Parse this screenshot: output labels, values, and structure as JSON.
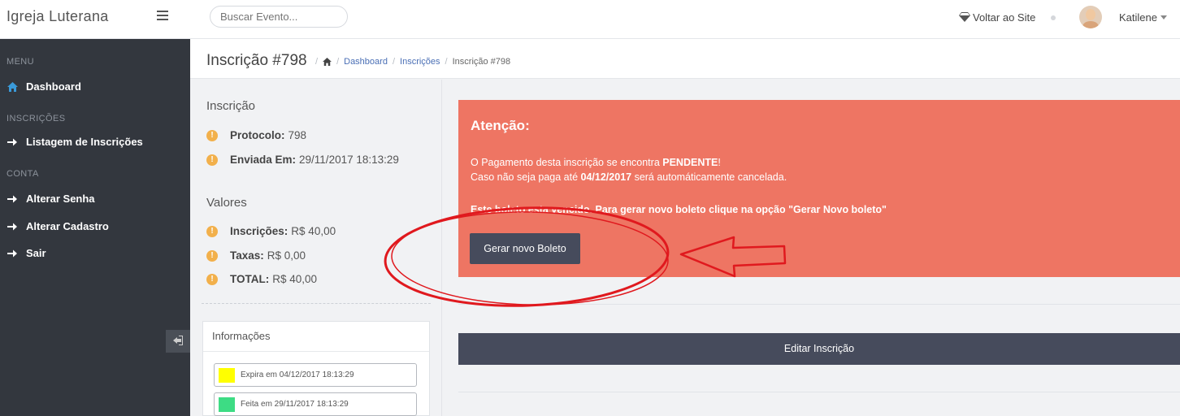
{
  "topbar": {
    "brand": "Igreja Luterana",
    "search_placeholder": "Buscar Evento...",
    "voltar_label": "Voltar ao Site",
    "user_name": "Katilene"
  },
  "sidebar": {
    "sections": [
      {
        "label": "MENU",
        "items": [
          {
            "label": "Dashboard",
            "icon": "home-icon"
          }
        ]
      },
      {
        "label": "INSCRIÇÕES",
        "items": [
          {
            "label": "Listagem de Inscrições",
            "icon": "arrow-right-icon"
          }
        ]
      },
      {
        "label": "CONTA",
        "items": [
          {
            "label": "Alterar Senha",
            "icon": "arrow-right-icon"
          },
          {
            "label": "Alterar Cadastro",
            "icon": "arrow-right-icon"
          },
          {
            "label": "Sair",
            "icon": "arrow-right-icon"
          }
        ]
      }
    ]
  },
  "page": {
    "title": "Inscrição #798",
    "breadcrumb": [
      "Dashboard",
      "Inscrições",
      "Inscrição #798"
    ]
  },
  "inscricao": {
    "heading": "Inscrição",
    "protocolo_label": "Protocolo:",
    "protocolo_value": "798",
    "enviada_label": "Enviada Em:",
    "enviada_value": "29/11/2017 18:13:29"
  },
  "valores": {
    "heading": "Valores",
    "inscricoes_label": "Inscrições:",
    "inscricoes_value": "R$ 40,00",
    "taxas_label": "Taxas:",
    "taxas_value": "R$ 0,00",
    "total_label": "TOTAL:",
    "total_value": "R$ 40,00"
  },
  "informacoes": {
    "heading": "Informações",
    "legend": [
      {
        "label": "Expira em 04/12/2017 18:13:29",
        "color": "#ffff00"
      },
      {
        "label": "Feita em 29/11/2017 18:13:29",
        "color": "#3ddc84"
      }
    ]
  },
  "alert": {
    "title": "Atenção:",
    "line1_prefix": "O Pagamento desta inscrição se encontra ",
    "line1_status": "PENDENTE",
    "line1_suffix": "!",
    "line2_prefix": "Caso não seja paga até ",
    "line2_date": "04/12/2017",
    "line2_suffix": " será automáticamente cancelada.",
    "line3": "Este boleto esta vencido. Para gerar novo boleto clique na opção \"Gerar Novo boleto\"",
    "button_label": "Gerar novo Boleto"
  },
  "editar_label": "Editar Inscrição",
  "colors": {
    "alert_bg": "#ee7563",
    "sidebar_bg": "#33373e",
    "button_bg": "#464b5c",
    "annotation": "#e0191e"
  }
}
